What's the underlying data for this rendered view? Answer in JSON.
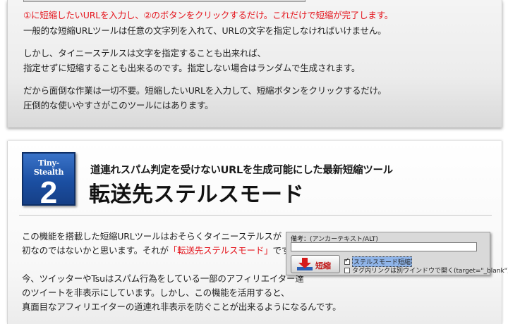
{
  "intro": {
    "line1": "①に短縮したいURLを入力し、②のボタンをクリックするだけ。これだけで短縮が完了します。",
    "line2": "一般的な短縮URLツールは任意の文字列を入れて、URLの文字を指定しなければいけません。",
    "line3": "しかし、タイニーステルスは文字を指定することも出来れば、",
    "line4": "指定せずに短縮することも出来るのです。指定しない場合はランダムで生成されます。",
    "line5": "だから面倒な作業は一切不要。短縮したいURLを入力して、短縮ボタンをクリックするだけ。",
    "line6": "圧倒的な使いやすさがこのツールにはあります。"
  },
  "feature": {
    "badge_brand": "Tiny-Stealth",
    "badge_number": "2",
    "subtitle": "道連れスパム判定を受けないURLを生成可能にした最新短縮ツール",
    "title": "転送先ステルスモード",
    "body": {
      "l1": "この機能を搭載した短縮URLツールはおそらくタイニーステルスが",
      "l2a": "初なのではないかと思います。それが",
      "l2b": "「転送先ステルスモード」",
      "l2c": "です。",
      "l3": "今、ツイッターやTsuはスパム行為をしている一部のアフィリエイター達",
      "l4": "のツイートを非表示にしています。しかし、この機能を活用すると、",
      "l5": "真面目なアフィリエイターの道連れ非表示を防ぐことが出来るようになるんです。"
    },
    "widget": {
      "label": "備考：(アンカーテキスト/ALT)",
      "input_value": "",
      "button_label": "短縮",
      "check1_label": "ステルスモード短縮",
      "check1_checked": true,
      "check2_label": "タグ内リンクは別ウインドウで開く(target=\"_blank\")",
      "check2_checked": false
    }
  },
  "colors": {
    "accent_red": "#e4141c",
    "badge_blue": "#1b4fa2"
  }
}
